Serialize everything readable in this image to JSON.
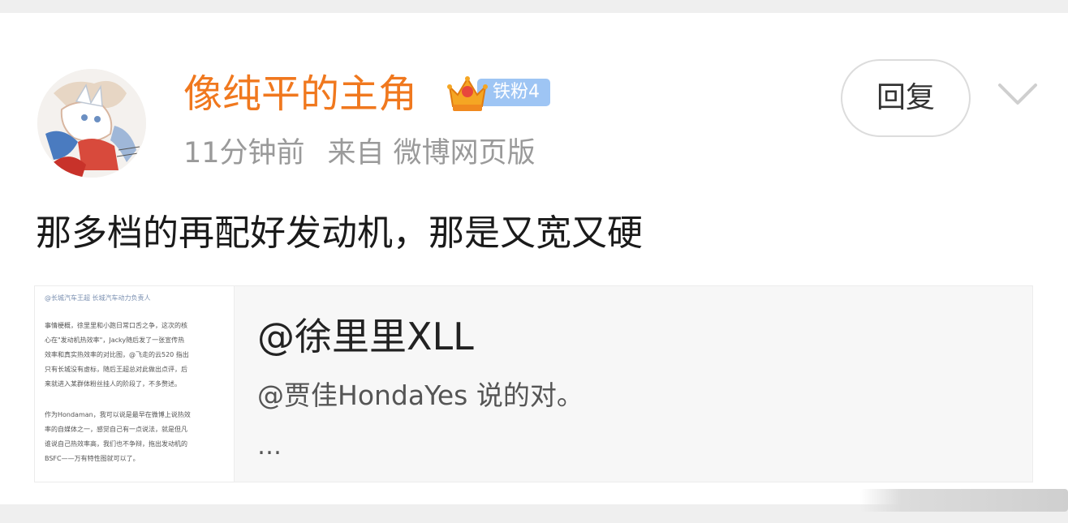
{
  "post": {
    "author": "像纯平的主角",
    "badge": "铁粉4",
    "time": "11分钟前",
    "source": "来自 微博网页版",
    "reply_label": "回复",
    "content": "那多档的再配好发动机，那是又宽又硬"
  },
  "quote": {
    "user": "@徐里里XLL",
    "text": "@贾佳HondaYes 说的对。",
    "more": "…",
    "thumbnail_lines": [
      "@长城汽车王超 长城汽车动力负责人",
      "事情梗概，徐里里和小跑日常口舌之争，这次的核",
      "心在\"发动机热效率\"，Jacky随后发了一张宣传热",
      "效率和真实热效率的对比图，@飞走的云520 指出",
      "只有长城没有虚标，随后王超总对此做出点评，后",
      "来就进入某群体粉丝挂人的阶段了，不多赘述。",
      "作为Hondaman，我可以说是最早在微博上说热效",
      "率的自媒体之一，感觉自己有一点说法，就是但凡",
      "谁说自己热效率高，我们也不争辩，拖出发动机的",
      "BSFC——万有特性图就可以了。"
    ]
  },
  "colors": {
    "author": "#f0781e",
    "badge_bg": "#9ec5f4",
    "meta": "#9a9a9a"
  },
  "icons": {
    "badge": "crown-icon",
    "menu": "chevron-down-icon"
  }
}
